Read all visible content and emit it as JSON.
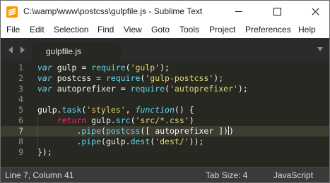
{
  "window": {
    "title": "C:\\wamp\\www\\postcss\\gulpfile.js - Sublime Text"
  },
  "menu": [
    "File",
    "Edit",
    "Selection",
    "Find",
    "View",
    "Goto",
    "Tools",
    "Project",
    "Preferences",
    "Help"
  ],
  "tabs": [
    {
      "label": "gulpfile.js",
      "active": true
    }
  ],
  "editor": {
    "current_line": 7,
    "lines": [
      {
        "no": "1",
        "tokens": [
          [
            "var",
            "kw-var"
          ],
          [
            " gulp = ",
            ""
          ],
          [
            "require",
            "fn"
          ],
          [
            "(",
            ""
          ],
          [
            "'gulp'",
            "str"
          ],
          [
            ");",
            ""
          ]
        ]
      },
      {
        "no": "2",
        "tokens": [
          [
            "var",
            "kw-var"
          ],
          [
            " postcss = ",
            ""
          ],
          [
            "require",
            "fn"
          ],
          [
            "(",
            ""
          ],
          [
            "'gulp-postcss'",
            "str"
          ],
          [
            ");",
            ""
          ]
        ]
      },
      {
        "no": "3",
        "tokens": [
          [
            "var",
            "kw-var"
          ],
          [
            " autoprefixer = ",
            ""
          ],
          [
            "require",
            "fn"
          ],
          [
            "(",
            ""
          ],
          [
            "'autoprefixer'",
            "str"
          ],
          [
            ");",
            ""
          ]
        ]
      },
      {
        "no": "4",
        "tokens": []
      },
      {
        "no": "5",
        "tokens": [
          [
            "gulp.",
            ""
          ],
          [
            "task",
            "fn"
          ],
          [
            "(",
            ""
          ],
          [
            "'styles'",
            "str"
          ],
          [
            ", ",
            ""
          ],
          [
            "function",
            "fn-kw"
          ],
          [
            "() {",
            ""
          ]
        ]
      },
      {
        "no": "6",
        "tokens": [
          [
            "    ",
            ""
          ],
          [
            "return",
            "kw"
          ],
          [
            " gulp.",
            ""
          ],
          [
            "src",
            "fn"
          ],
          [
            "(",
            ""
          ],
          [
            "'src/*.css'",
            "str"
          ],
          [
            ")",
            ""
          ]
        ]
      },
      {
        "no": "7",
        "tokens": [
          [
            "        .",
            ""
          ],
          [
            "pipe",
            "fn"
          ],
          [
            "(",
            ""
          ],
          [
            "postcss",
            "fn"
          ],
          [
            "([ autoprefixer ])",
            ""
          ],
          [
            "|cursor|",
            "cursor"
          ],
          [
            ")",
            ""
          ]
        ]
      },
      {
        "no": "8",
        "tokens": [
          [
            "        .",
            ""
          ],
          [
            "pipe",
            "fn"
          ],
          [
            "(gulp.",
            ""
          ],
          [
            "dest",
            "fn"
          ],
          [
            "(",
            ""
          ],
          [
            "'dest/'",
            "str"
          ],
          [
            "));",
            ""
          ]
        ]
      },
      {
        "no": "9",
        "tokens": [
          [
            "});",
            ""
          ]
        ]
      }
    ]
  },
  "status": {
    "position": "Line 7, Column 41",
    "tab_size": "Tab Size: 4",
    "syntax": "JavaScript"
  }
}
